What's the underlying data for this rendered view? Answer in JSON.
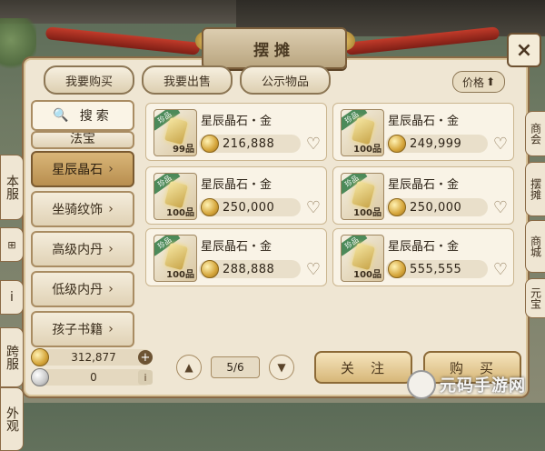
{
  "window": {
    "title": "摆摊",
    "close_label": "×"
  },
  "tabs": [
    {
      "label": "我要购买"
    },
    {
      "label": "我要出售"
    },
    {
      "label": "公示物品"
    }
  ],
  "sort": {
    "label": "价格",
    "arrow": "⬆"
  },
  "left_nav": {
    "seal": "珍",
    "items": [
      "本服",
      "跨服",
      "外观"
    ],
    "small_icons": [
      "⊞",
      "i"
    ]
  },
  "categories": {
    "search_label": "搜索",
    "search_icon": "🔍",
    "partial_label": "法宝",
    "items": [
      {
        "label": "星辰晶石",
        "selected": true
      },
      {
        "label": "坐骑纹饰",
        "selected": false
      },
      {
        "label": "高级内丹",
        "selected": false
      },
      {
        "label": "低级内丹",
        "selected": false
      },
      {
        "label": "孩子书籍",
        "selected": false
      }
    ],
    "chevron": "›"
  },
  "listings": [
    {
      "name": "星辰晶石・金",
      "qty": "99品",
      "badge": "珍品",
      "price": "216,888"
    },
    {
      "name": "星辰晶石・金",
      "qty": "100品",
      "badge": "珍品",
      "price": "249,999"
    },
    {
      "name": "星辰晶石・金",
      "qty": "100品",
      "badge": "珍品",
      "price": "250,000"
    },
    {
      "name": "星辰晶石・金",
      "qty": "100品",
      "badge": "珍品",
      "price": "250,000"
    },
    {
      "name": "星辰晶石・金",
      "qty": "100品",
      "badge": "珍品",
      "price": "288,888"
    },
    {
      "name": "星辰晶石・金",
      "qty": "100品",
      "badge": "珍品",
      "price": "555,555"
    }
  ],
  "wallet": {
    "gold": "312,877",
    "silver": "0"
  },
  "pager": {
    "current": "5/6",
    "prev": "▲",
    "next": "▼"
  },
  "actions": {
    "follow": "关注",
    "buy": "购买"
  },
  "right_tabs": [
    "商会",
    "摆摊",
    "商城",
    "元宝"
  ],
  "watermark": {
    "text": "元码手游网"
  }
}
